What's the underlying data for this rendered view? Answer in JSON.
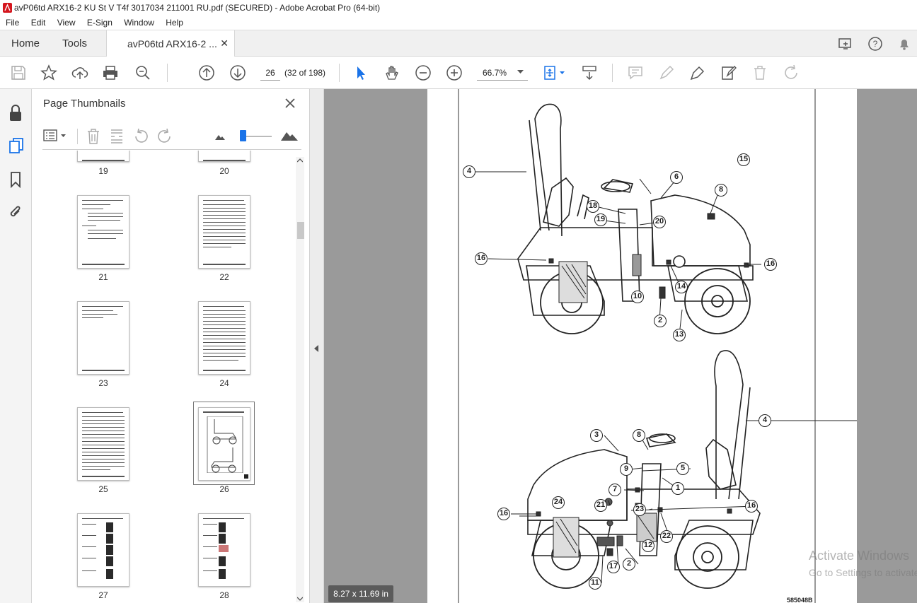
{
  "window": {
    "title": "avP06td ARX16-2 KU St V T4f 3017034 211001 RU.pdf (SECURED) - Adobe Acrobat Pro (64-bit)"
  },
  "menu": [
    "File",
    "Edit",
    "View",
    "E-Sign",
    "Window",
    "Help"
  ],
  "tabs": {
    "home": "Home",
    "tools": "Tools",
    "document": "avP06td ARX16-2 ..."
  },
  "toolbar": {
    "page_number": "26",
    "page_count": "(32 of 198)",
    "zoom": "66.7%"
  },
  "panel": {
    "title": "Page Thumbnails",
    "pages": [
      {
        "label": "19"
      },
      {
        "label": "20"
      },
      {
        "label": "21"
      },
      {
        "label": "22"
      },
      {
        "label": "23"
      },
      {
        "label": "24"
      },
      {
        "label": "25"
      },
      {
        "label": "26",
        "selected": true
      },
      {
        "label": "27"
      },
      {
        "label": "28"
      }
    ]
  },
  "document": {
    "page_size": "8.27 x 11.69 in",
    "figure_code": "585048B",
    "callouts_top": [
      "4",
      "15",
      "6",
      "8",
      "18",
      "19",
      "20",
      "16",
      "16",
      "14",
      "10",
      "2",
      "13"
    ],
    "callouts_bottom": [
      "4",
      "3",
      "8",
      "9",
      "5",
      "7",
      "1",
      "16",
      "24",
      "21",
      "23",
      "16",
      "22",
      "12",
      "2",
      "17",
      "11"
    ]
  },
  "watermark": {
    "line1": "Activate Windows",
    "line2": "Go to Settings to activate Windows."
  }
}
